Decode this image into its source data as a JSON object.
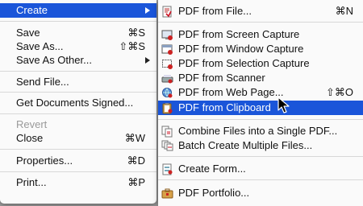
{
  "file_menu": {
    "items": [
      {
        "label": "Create",
        "shortcut": "",
        "submenu": true,
        "active": true
      },
      {
        "label": "Save",
        "shortcut": "⌘S"
      },
      {
        "label": "Save As...",
        "shortcut": "⇧⌘S"
      },
      {
        "label": "Save As Other...",
        "shortcut": "",
        "submenu": true
      },
      {
        "label": "Send File...",
        "shortcut": ""
      },
      {
        "label": "Get Documents Signed...",
        "shortcut": ""
      },
      {
        "label": "Revert",
        "shortcut": "",
        "disabled": true
      },
      {
        "label": "Close",
        "shortcut": "⌘W"
      },
      {
        "label": "Properties...",
        "shortcut": "⌘D"
      },
      {
        "label": "Print...",
        "shortcut": "⌘P"
      }
    ]
  },
  "create_menu": {
    "items": [
      {
        "label": "PDF from File...",
        "shortcut": "⌘N",
        "icon": "pdf-file-icon"
      },
      {
        "label": "PDF from Screen Capture",
        "shortcut": "",
        "icon": "screen-capture-icon"
      },
      {
        "label": "PDF from Window Capture",
        "shortcut": "",
        "icon": "window-capture-icon"
      },
      {
        "label": "PDF from Selection Capture",
        "shortcut": "",
        "icon": "selection-capture-icon"
      },
      {
        "label": "PDF from Scanner",
        "shortcut": "",
        "icon": "scanner-icon"
      },
      {
        "label": "PDF from Web Page...",
        "shortcut": "⇧⌘O",
        "icon": "web-page-icon"
      },
      {
        "label": "PDF from Clipboard",
        "shortcut": "",
        "icon": "clipboard-icon",
        "active": true
      },
      {
        "label": "Combine Files into a Single PDF...",
        "shortcut": "",
        "icon": "combine-files-icon"
      },
      {
        "label": "Batch Create Multiple Files...",
        "shortcut": "",
        "icon": "batch-create-icon"
      },
      {
        "label": "Create Form...",
        "shortcut": "",
        "icon": "form-icon"
      },
      {
        "label": "PDF Portfolio...",
        "shortcut": "",
        "icon": "portfolio-icon"
      }
    ]
  },
  "colors": {
    "highlight": "#1a55d9",
    "menu_bg": "#fafafa",
    "disabled_text": "#9a9a9a"
  }
}
